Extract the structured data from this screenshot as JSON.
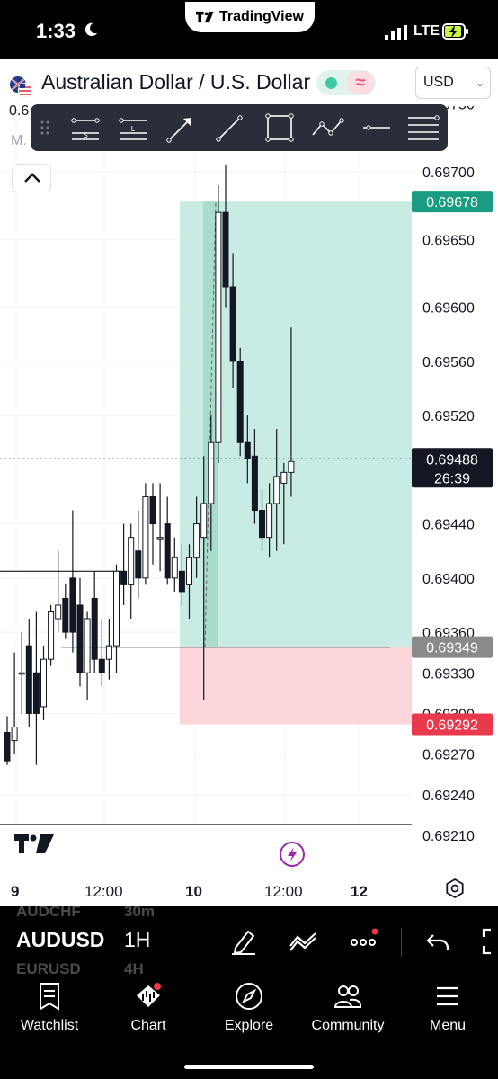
{
  "status": {
    "time": "1:33",
    "app_pill": "TradingView",
    "network": "LTE"
  },
  "header": {
    "symbol_title": "Australian Dollar / U.S. Dollar",
    "currency": "USD",
    "market_icon": "market-status-waves"
  },
  "chart_overlay": {
    "partial_value": "0.6",
    "partial_indicator": "M."
  },
  "price_axis": {
    "ticks": [
      "0.69750",
      "0.69700",
      "0.69650",
      "0.69600",
      "0.69560",
      "0.69520",
      "0.69440",
      "0.69400",
      "0.69360",
      "0.69330",
      "0.69300",
      "0.69270",
      "0.69240",
      "0.69210"
    ],
    "badges": [
      {
        "text": "0.69678",
        "color": "#1a9c82",
        "kind": "take-profit"
      },
      {
        "text": "0.69349",
        "color": "#8a8a8a",
        "kind": "entry"
      },
      {
        "text": "0.69292",
        "color": "#e8394d",
        "kind": "stop-loss"
      }
    ],
    "last_price": "0.69488",
    "countdown": "26:39"
  },
  "time_axis": {
    "labels": [
      "9",
      "12:00",
      "10",
      "12:00",
      "12"
    ]
  },
  "toolbar": {
    "symbol": "AUDUSD",
    "interval": "1H",
    "ghost_above": [
      "AUDCHF",
      "30m"
    ],
    "ghost_below": [
      "EURUSD",
      "4H"
    ]
  },
  "nav": {
    "items": [
      {
        "label": "Watchlist",
        "icon": "watchlist-icon"
      },
      {
        "label": "Chart",
        "icon": "chart-icon"
      },
      {
        "label": "Explore",
        "icon": "compass-icon"
      },
      {
        "label": "Community",
        "icon": "community-icon"
      },
      {
        "label": "Menu",
        "icon": "menu-icon"
      }
    ]
  },
  "colors": {
    "profit_zone": "#c8ece3",
    "loss_zone": "#fbd7dc",
    "accent_purple": "#9c27b0"
  },
  "chart_data": {
    "type": "candlestick",
    "symbol": "AUDUSD",
    "interval": "1H",
    "ylim": [
      0.69195,
      0.69765
    ],
    "x_ticks": [
      "9",
      "12:00",
      "10",
      "12:00",
      "12"
    ],
    "position": {
      "type": "long",
      "entry": 0.69349,
      "take_profit": 0.69678,
      "stop_loss": 0.69292
    },
    "horizontal_lines": [
      0.69349,
      0.69405
    ],
    "last_price": 0.69488,
    "candles": [
      [
        0.69286,
        0.69298,
        0.69262,
        0.69265
      ],
      [
        0.6928,
        0.69345,
        0.6927,
        0.6929
      ],
      [
        0.6933,
        0.6936,
        0.693,
        0.6933
      ],
      [
        0.6935,
        0.6937,
        0.6929,
        0.693
      ],
      [
        0.6933,
        0.69375,
        0.69262,
        0.693
      ],
      [
        0.69305,
        0.6935,
        0.69295,
        0.6934
      ],
      [
        0.6934,
        0.6938,
        0.69335,
        0.69375
      ],
      [
        0.6937,
        0.6942,
        0.6936,
        0.6938
      ],
      [
        0.69385,
        0.69396,
        0.69355,
        0.6936
      ],
      [
        0.694,
        0.6945,
        0.69345,
        0.6936
      ],
      [
        0.6938,
        0.694,
        0.6932,
        0.6933
      ],
      [
        0.6933,
        0.69375,
        0.6931,
        0.6937
      ],
      [
        0.69385,
        0.69405,
        0.6933,
        0.6934
      ],
      [
        0.6934,
        0.6937,
        0.6932,
        0.6933
      ],
      [
        0.6934,
        0.6937,
        0.69325,
        0.6935
      ],
      [
        0.6935,
        0.6941,
        0.6933,
        0.69405
      ],
      [
        0.69405,
        0.6944,
        0.6938,
        0.69395
      ],
      [
        0.69395,
        0.6944,
        0.6937,
        0.6943
      ],
      [
        0.6942,
        0.6945,
        0.69385,
        0.694
      ],
      [
        0.694,
        0.6947,
        0.69395,
        0.6946
      ],
      [
        0.6946,
        0.6947,
        0.6941,
        0.6944
      ],
      [
        0.6943,
        0.6947,
        0.69405,
        0.6943
      ],
      [
        0.6944,
        0.6946,
        0.69395,
        0.694
      ],
      [
        0.694,
        0.6943,
        0.6939,
        0.69415
      ],
      [
        0.69405,
        0.69425,
        0.6938,
        0.6939
      ],
      [
        0.69395,
        0.69425,
        0.6937,
        0.69415
      ],
      [
        0.69415,
        0.6946,
        0.694,
        0.6944
      ],
      [
        0.6943,
        0.6949,
        0.6931,
        0.69455
      ],
      [
        0.69455,
        0.6952,
        0.6942,
        0.695
      ],
      [
        0.695,
        0.6969,
        0.69485,
        0.6967
      ],
      [
        0.6967,
        0.69705,
        0.696,
        0.69615
      ],
      [
        0.69615,
        0.6964,
        0.6954,
        0.6956
      ],
      [
        0.6956,
        0.6957,
        0.6949,
        0.695
      ],
      [
        0.695,
        0.6952,
        0.6947,
        0.69488
      ],
      [
        0.6949,
        0.6951,
        0.6944,
        0.6945
      ],
      [
        0.6945,
        0.69465,
        0.6942,
        0.6943
      ],
      [
        0.6943,
        0.6947,
        0.69415,
        0.69455
      ],
      [
        0.69455,
        0.6951,
        0.6942,
        0.69475
      ],
      [
        0.6947,
        0.69485,
        0.69425,
        0.69478
      ],
      [
        0.69478,
        0.69585,
        0.6946,
        0.69486
      ]
    ]
  }
}
